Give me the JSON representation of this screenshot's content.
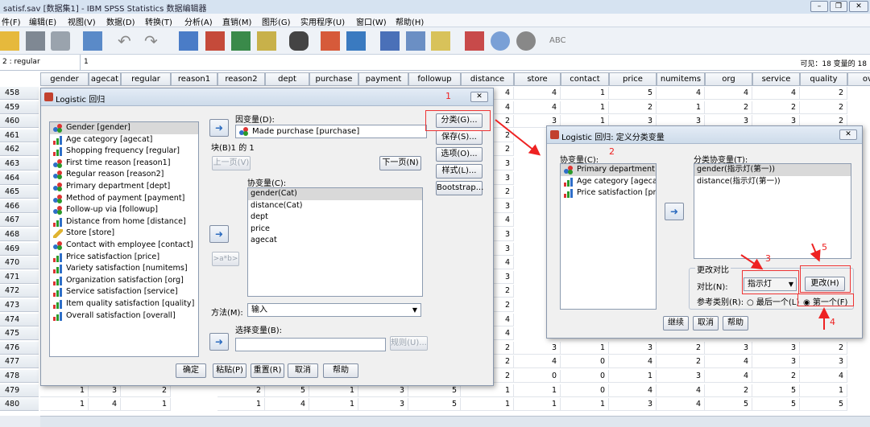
{
  "window": {
    "title": "satisf.sav [数据集1] - IBM SPSS Statistics 数据编辑器"
  },
  "menu": [
    "件(F)",
    "编辑(E)",
    "视图(V)",
    "数据(D)",
    "转换(T)",
    "分析(A)",
    "直销(M)",
    "图形(G)",
    "实用程序(U)",
    "窗口(W)",
    "帮助(H)"
  ],
  "cellbar": {
    "ref": "2 : regular",
    "value": "1",
    "visible": "可见：18 变量的 18"
  },
  "grid": {
    "columns": [
      "gender",
      "agecat",
      "regular",
      "reason1",
      "reason2",
      "dept",
      "purchase",
      "payment",
      "followup",
      "distance",
      "store",
      "contact",
      "price",
      "numitems",
      "org",
      "service",
      "quality",
      "over"
    ],
    "rows": [
      "458",
      "459",
      "460",
      "461",
      "462",
      "463",
      "464",
      "465",
      "466",
      "467",
      "468",
      "469",
      "470",
      "471",
      "472",
      "473",
      "474",
      "475",
      "476",
      "477",
      "478",
      "479",
      "480"
    ],
    "visible_values": {
      "distance": [
        "4",
        "4",
        "2",
        "2",
        "2",
        "3",
        "3",
        "2",
        "3",
        "4",
        "3",
        "3",
        "4",
        "3",
        "2",
        "2",
        "4",
        "4",
        "2",
        "2",
        "2",
        "1",
        "1"
      ],
      "store_458_460": [
        "4",
        "4",
        "3"
      ],
      "contact_458_460": [
        "1",
        "1",
        "1"
      ],
      "price_458_460": [
        "5",
        "2",
        "3"
      ],
      "numitems_458_460": [
        "4",
        "1",
        "3"
      ],
      "org_458_460": [
        "4",
        "2",
        "3"
      ],
      "service_458_460": [
        "4",
        "2",
        "3"
      ],
      "quality_458_460": [
        "2",
        "2",
        "2"
      ],
      "store_476_480": [
        "3",
        "4",
        "0",
        "1",
        "1"
      ],
      "contact_476_480": [
        "1",
        "0",
        "0",
        "0",
        "1"
      ],
      "price_476_480": [
        "3",
        "4",
        "1",
        "4",
        "3"
      ],
      "numitems_476_480": [
        "2",
        "2",
        "3",
        "4",
        "4"
      ],
      "org_476_480": [
        "3",
        "4",
        "4",
        "2",
        "5"
      ],
      "service_476_480": [
        "3",
        "3",
        "2",
        "5",
        "5"
      ],
      "quality_476_480": [
        "2",
        "3",
        "4",
        "1",
        "5"
      ],
      "left_479": [
        "1",
        "3",
        "2",
        "",
        "2",
        "5",
        "1",
        "3",
        "5"
      ],
      "left_480": [
        "1",
        "4",
        "1",
        "",
        "1",
        "4",
        "1",
        "3",
        "5"
      ]
    }
  },
  "dlg1": {
    "title": "Logistic 回归",
    "vars": [
      {
        "label": "Gender [gender]",
        "type": "nominal",
        "selected": true
      },
      {
        "label": "Age category [agecat]",
        "type": "ordinal"
      },
      {
        "label": "Shopping frequency [regular]",
        "type": "ordinal"
      },
      {
        "label": "First time reason [reason1]",
        "type": "nominal"
      },
      {
        "label": "Regular reason [reason2]",
        "type": "nominal"
      },
      {
        "label": "Primary department [dept]",
        "type": "nominal"
      },
      {
        "label": "Method of payment [payment]",
        "type": "nominal"
      },
      {
        "label": "Follow-up via [followup]",
        "type": "nominal"
      },
      {
        "label": "Distance from home [distance]",
        "type": "ordinal"
      },
      {
        "label": "Store [store]",
        "type": "scale"
      },
      {
        "label": "Contact with employee [contact]",
        "type": "nominal"
      },
      {
        "label": "Price satisfaction [price]",
        "type": "ordinal"
      },
      {
        "label": "Variety satisfaction [numitems]",
        "type": "ordinal"
      },
      {
        "label": "Organization satisfaction [org]",
        "type": "ordinal"
      },
      {
        "label": "Service satisfaction [service]",
        "type": "ordinal"
      },
      {
        "label": "Item quality satisfaction [quality]",
        "type": "ordinal"
      },
      {
        "label": "Overall satisfaction [overall]",
        "type": "ordinal"
      }
    ],
    "dep_label": "因变量(D):",
    "dep_value": "Made purchase [purchase]",
    "block_label": "块(B)1 的 1",
    "prev": "上一页(V)",
    "next": "下一页(N)",
    "cov_label": "协变量(C):",
    "covs": [
      "gender(Cat)",
      "distance(Cat)",
      "dept",
      "price",
      "agecat"
    ],
    "interact": ">a*b>",
    "method_label": "方法(M):",
    "method": "输入",
    "selvar_label": "选择变量(B):",
    "rule": "规则(U)...",
    "side": [
      "分类(G)...",
      "保存(S)...",
      "选项(O)...",
      "样式(L)...",
      "Bootstrap..."
    ],
    "bottom": [
      "确定",
      "粘贴(P)",
      "重置(R)",
      "取消",
      "帮助"
    ]
  },
  "dlg2": {
    "title": "Logistic 回归: 定义分类变量",
    "cov_label": "协变量(C):",
    "covs": [
      "Primary department ...",
      "Age category [agecat]",
      "Price satisfaction [pr..."
    ],
    "cat_label": "分类协变量(T):",
    "cats": [
      "gender(指示灯(第一))",
      "distance(指示灯(第一))"
    ],
    "group": "更改对比",
    "contrast_label": "对比(N):",
    "contrast": "指示灯",
    "change": "更改(H)",
    "ref_label": "参考类别(R):",
    "last": "最后一个(L)",
    "first": "第一个(F)",
    "bottom": [
      "继续",
      "取消",
      "帮助"
    ]
  },
  "annotations": [
    "1",
    "2",
    "3",
    "4",
    "5"
  ],
  "colors": {
    "red_annotation": "#e22",
    "selection": "#d9d9d9"
  }
}
